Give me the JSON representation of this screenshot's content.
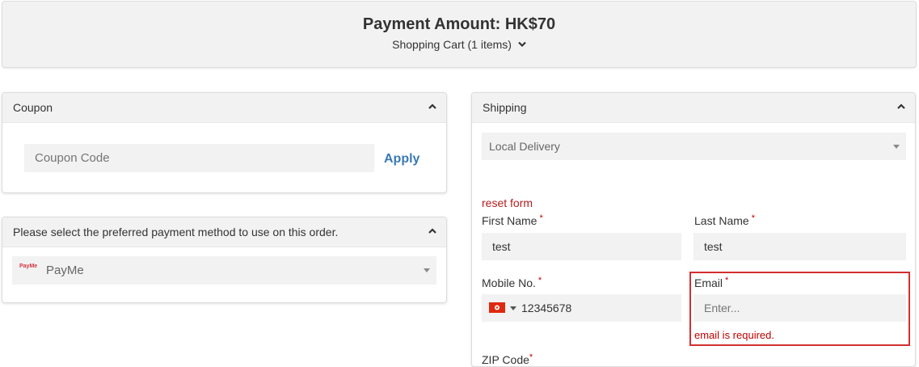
{
  "header": {
    "payment_amount": "Payment Amount: HK$70",
    "cart_label": "Shopping Cart (1 items)"
  },
  "coupon": {
    "title": "Coupon",
    "placeholder": "Coupon Code",
    "apply_label": "Apply"
  },
  "payment": {
    "title": "Please select the preferred payment method to use on this order.",
    "selected": "PayMe",
    "logo_text": "PayMe"
  },
  "shipping": {
    "title": "Shipping",
    "method": "Local Delivery",
    "reset_label": "reset form",
    "first_name_label": "First Name",
    "first_name_value": "test",
    "last_name_label": "Last Name",
    "last_name_value": "test",
    "mobile_label": "Mobile No.",
    "mobile_value": "12345678",
    "email_label": "Email",
    "email_placeholder": "Enter...",
    "email_error": "email is required.",
    "zip_label": "ZIP Code",
    "required_mark": "*"
  },
  "colors": {
    "accent_link": "#3a7ab5",
    "error": "#c00000",
    "field_bg": "#f2f2f2",
    "panel_head_bg": "#f2f2f2"
  }
}
